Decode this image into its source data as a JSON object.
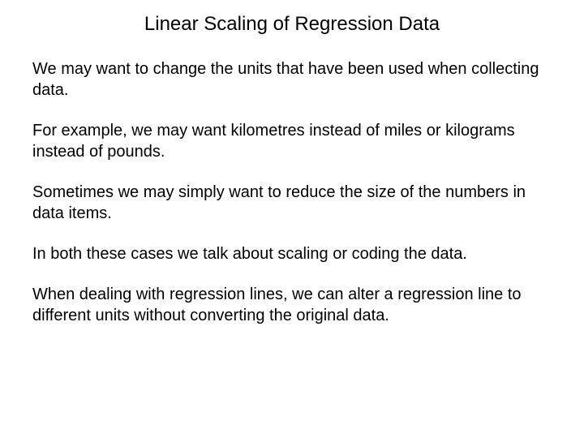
{
  "title": "Linear Scaling of Regression Data",
  "paragraphs": {
    "p1": "We may want to change the units that have been used when collecting data.",
    "p2": "For example, we may want kilometres instead of miles or kilograms instead of pounds.",
    "p3": "Sometimes we may simply want to reduce the size of the numbers in data items.",
    "p4": "In both these cases we talk about scaling or coding the data.",
    "p5": "When dealing with regression lines, we can alter a regression line to different units without converting the original data."
  }
}
